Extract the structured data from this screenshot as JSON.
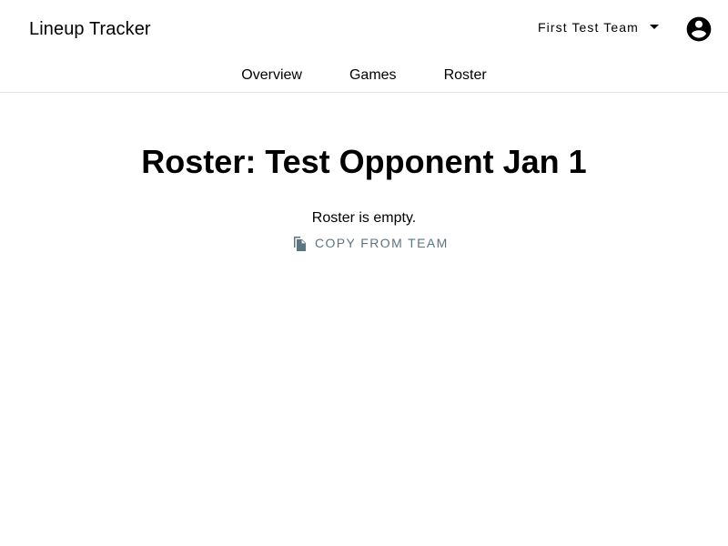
{
  "header": {
    "app_title": "Lineup Tracker",
    "team_select": {
      "selected": "First Test Team",
      "caret_icon": "caret-down-icon"
    },
    "account_icon": "account-circle-icon"
  },
  "nav": {
    "tabs": [
      {
        "label": "Overview"
      },
      {
        "label": "Games"
      },
      {
        "label": "Roster"
      }
    ]
  },
  "main": {
    "title": "Roster: Test Opponent Jan 1",
    "empty_message": "Roster is empty.",
    "copy_button": {
      "label": "COPY FROM TEAM",
      "icon": "file-copy-icon"
    }
  },
  "colors": {
    "text": "#000000",
    "accent_button": "#5b7583",
    "divider": "#e6e6e6",
    "background": "#ffffff"
  }
}
